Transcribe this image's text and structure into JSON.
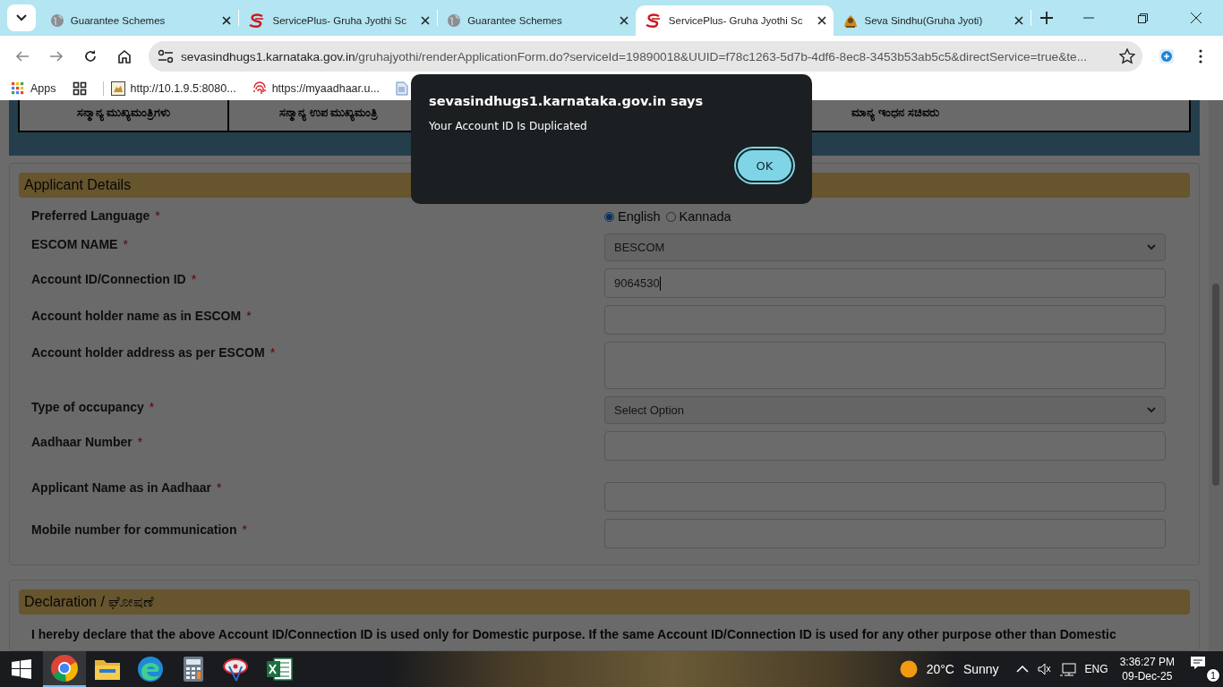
{
  "browser": {
    "tabs": [
      {
        "title": "Guarantee Schemes",
        "selected": false
      },
      {
        "title": "ServicePlus- Gruha Jyothi Sc",
        "selected": false
      },
      {
        "title": "Guarantee Schemes",
        "selected": false
      },
      {
        "title": "ServicePlus- Gruha Jyothi Sc",
        "selected": true
      },
      {
        "title": "Seva Sindhu(Gruha Jyoti)",
        "selected": false
      }
    ],
    "url": {
      "host": "sevasindhugs1.karnataka.gov.in",
      "path": "/gruhajyothi/renderApplicationForm.do?serviceId=19890018&UUID=f78c1263-5d7b-4df6-8ec8-3453b53ab5c5&directService=true&te..."
    },
    "bookmarks": [
      "Apps",
      "http://10.1.9.5:8080...",
      "https://myaadhaar.u..."
    ]
  },
  "banner": {
    "cells": [
      "ಸನ್ಮಾನ್ಯ ಮುಖ್ಯಮಂತ್ರಿಗಳು",
      "ಸನ್ಮಾನ್ಯ ಉಪ ಮುಖ್ಯಮಂತ್ರಿ",
      "ಮಾನ್ಯ ಇಂಧನ ಸಚಿವರು"
    ]
  },
  "applicant_details": {
    "title": "Applicant Details",
    "fields": [
      {
        "label": "Preferred Language",
        "required_mark": "*",
        "kind": "radio",
        "options": [
          {
            "label": "English",
            "selected": true
          },
          {
            "label": "Kannada",
            "selected": false
          }
        ]
      },
      {
        "label": "ESCOM NAME",
        "required_mark": "*",
        "kind": "select",
        "value": "BESCOM"
      },
      {
        "label": "Account ID/Connection ID",
        "required_mark": "*",
        "kind": "text",
        "value": "9064530"
      },
      {
        "label": "Account holder name as in ESCOM",
        "required_mark": "*",
        "kind": "text"
      },
      {
        "label": "Account holder address as per ESCOM",
        "required_mark": "*",
        "kind": "textarea"
      },
      {
        "label": "Type of occupancy",
        "required_mark": "*",
        "kind": "select",
        "value": "Select Option"
      },
      {
        "label": "Aadhaar Number",
        "required_mark": "*",
        "kind": "text"
      },
      {
        "label": "Applicant Name as in Aadhaar",
        "required_mark": "*",
        "kind": "text"
      },
      {
        "label": "Mobile number for communication",
        "required_mark": "*",
        "kind": "text"
      }
    ]
  },
  "declaration": {
    "title": "Declaration / ಘೋಷಣೆ",
    "text": "I hereby declare that the above Account ID/Connection ID is used only for Domestic purpose. If the same Account ID/Connection ID is used for any other purpose other than Domestic"
  },
  "dialog": {
    "title": "sevasindhugs1.karnataka.gov.in says",
    "message": "Your Account ID Is Duplicated",
    "button": "OK"
  },
  "taskbar": {
    "apps": [
      {
        "active": true
      },
      {
        "active": false
      },
      {
        "active": false
      },
      {
        "active": false
      },
      {
        "active": false
      },
      {
        "active": false
      }
    ],
    "weather": {
      "temp": "20°C",
      "condition": "Sunny"
    },
    "language": "ENG",
    "time": "3:36:27 PM",
    "date": "09-Dec-25",
    "notifications": "1"
  }
}
